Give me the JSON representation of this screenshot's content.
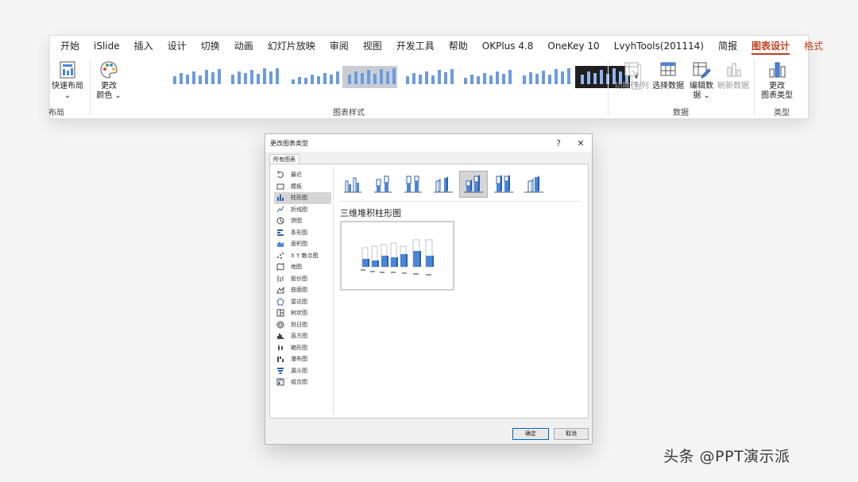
{
  "ribbon": {
    "tabs": [
      "开始",
      "iSlide",
      "插入",
      "设计",
      "切换",
      "动画",
      "幻灯片放映",
      "审阅",
      "视图",
      "开发工具",
      "帮助",
      "OKPlus 4.8",
      "OneKey 10",
      "LvyhTools(201114)",
      "简报",
      "图表设计",
      "格式"
    ],
    "active_tab": "图表设计",
    "groups": {
      "layout": {
        "label": "布局",
        "quick_layout": "快速布局",
        "quick_layout_arrow": "⌄"
      },
      "styles": {
        "label": "图表样式",
        "change_colors_1": "更改",
        "change_colors_2": "颜色 ⌄"
      },
      "data": {
        "label": "数据",
        "switch_row_col": "切换行/列",
        "select_data": "选择数据",
        "edit_data_1": "编辑数",
        "edit_data_2": "据 ⌄",
        "refresh_data": "刷新数据"
      },
      "type": {
        "label": "类型",
        "change_type_1": "更改",
        "change_type_2": "图表类型"
      }
    }
  },
  "dialog": {
    "title": "更改图表类型",
    "help": "?",
    "close": "✕",
    "tab": "所有图表",
    "categories": [
      "最近",
      "模板",
      "柱形图",
      "折线图",
      "饼图",
      "条形图",
      "面积图",
      "X Y 散点图",
      "地图",
      "股价图",
      "曲面图",
      "雷达图",
      "树状图",
      "旭日图",
      "直方图",
      "箱形图",
      "瀑布图",
      "漏斗图",
      "组合图"
    ],
    "selected_category": "柱形图",
    "selected_chart_name": "三维堆积柱形图",
    "ok": "确定",
    "cancel": "取消"
  },
  "watermark": "头条 @PPT演示派",
  "colors": {
    "accent": "#c43e1c",
    "chart_blue": "#4a86d8",
    "selection": "#d5d5d5"
  }
}
